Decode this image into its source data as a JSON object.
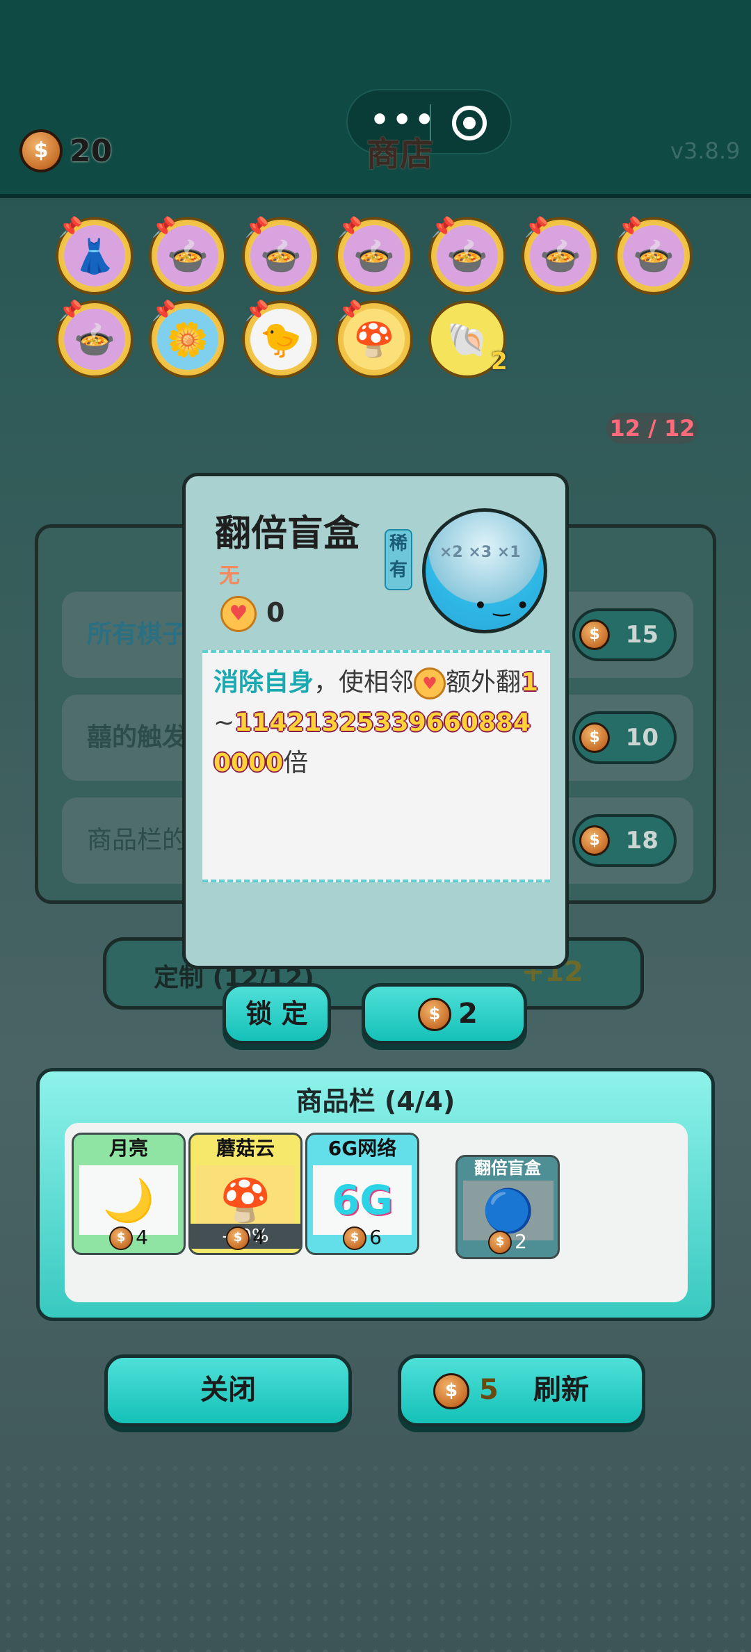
{
  "header": {
    "coins": "20",
    "title": "商店",
    "version": "v3.8.9",
    "menu_dots": "•••"
  },
  "owned_items": [
    {
      "icon": "skirt-icon"
    },
    {
      "icon": "double-bowl-icon"
    },
    {
      "icon": "double-bowl-icon"
    },
    {
      "icon": "double-bowl-icon"
    },
    {
      "icon": "double-bowl-icon"
    },
    {
      "icon": "double-bowl-icon"
    },
    {
      "icon": "double-bowl-icon"
    },
    {
      "icon": "double-bowl-icon"
    },
    {
      "icon": "potted-plant-icon"
    },
    {
      "icon": "rice-cooker-duck-icon"
    },
    {
      "icon": "mushroom-cloud-icon"
    },
    {
      "icon": "shell-icon",
      "count": "2"
    }
  ],
  "capacity": "12 / 12",
  "panel_rows": [
    {
      "text": "所有棋子",
      "price": "15"
    },
    {
      "text": "囍的触发",
      "price": "10"
    },
    {
      "text": "商品栏的",
      "price": "18"
    }
  ],
  "custom_bar": {
    "label": "定制 (12/12)",
    "price": "+12"
  },
  "lock_button": "锁 定",
  "unlock_price": "2",
  "popup": {
    "name": "翻倍盲盒",
    "rarity": "稀有",
    "tag": "无",
    "heart_value": "0",
    "desc_kw": "消除自身",
    "desc_mid": "，使相邻",
    "desc_after": "额外翻",
    "desc_num1": "1",
    "desc_tilde": "~",
    "desc_num2": "11421325339660884000​0",
    "desc_end": "倍",
    "ball_multipliers": "×2 ×3 ×1"
  },
  "shop": {
    "header": "商品栏 (4/4)",
    "cards": [
      {
        "name": "月亮",
        "price": "4",
        "color": "#8fe3a3"
      },
      {
        "name": "蘑菇云",
        "price": "4",
        "color": "#f6e86a",
        "discount": "-50%"
      },
      {
        "name": "6G网络",
        "price": "6",
        "color": "#62dfe8"
      },
      {
        "name": "翻倍盲盒",
        "price": "2",
        "color": "#4e8f95"
      }
    ]
  },
  "close_button": "关闭",
  "refresh": {
    "cost": "5",
    "label": "刷新"
  },
  "coin_symbol": "$"
}
